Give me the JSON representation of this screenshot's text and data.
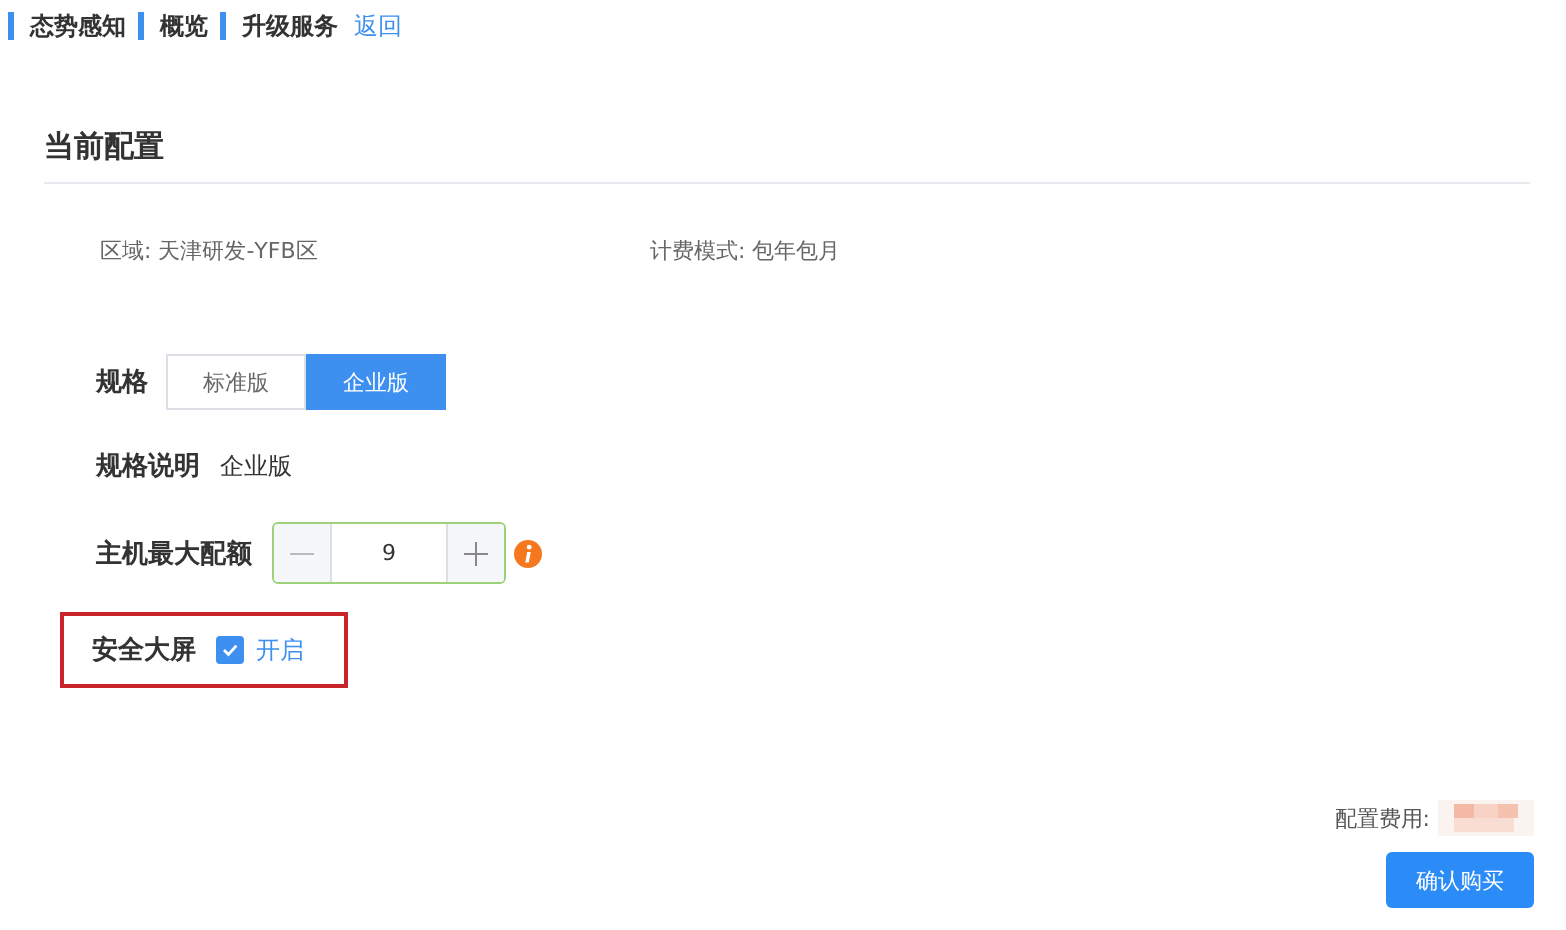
{
  "breadcrumb": [
    {
      "label": "态势感知"
    },
    {
      "label": "概览"
    },
    {
      "label": "升级服务"
    }
  ],
  "back_link": "返回",
  "section_title": "当前配置",
  "info": [
    "区域: 天津研发-YFB区",
    "计费模式: 包年包月"
  ],
  "spec": {
    "label": "规格",
    "options": [
      {
        "label": "标准版",
        "selected": false
      },
      {
        "label": "企业版",
        "selected": true
      }
    ]
  },
  "spec_desc": {
    "label": "规格说明",
    "value": "企业版"
  },
  "quota": {
    "label": "主机最大配额",
    "value": "9"
  },
  "big_screen": {
    "label": "安全大屏",
    "checked": true,
    "option": "开启"
  },
  "fee_label": "配置费用:",
  "buy_button": "确认购买"
}
